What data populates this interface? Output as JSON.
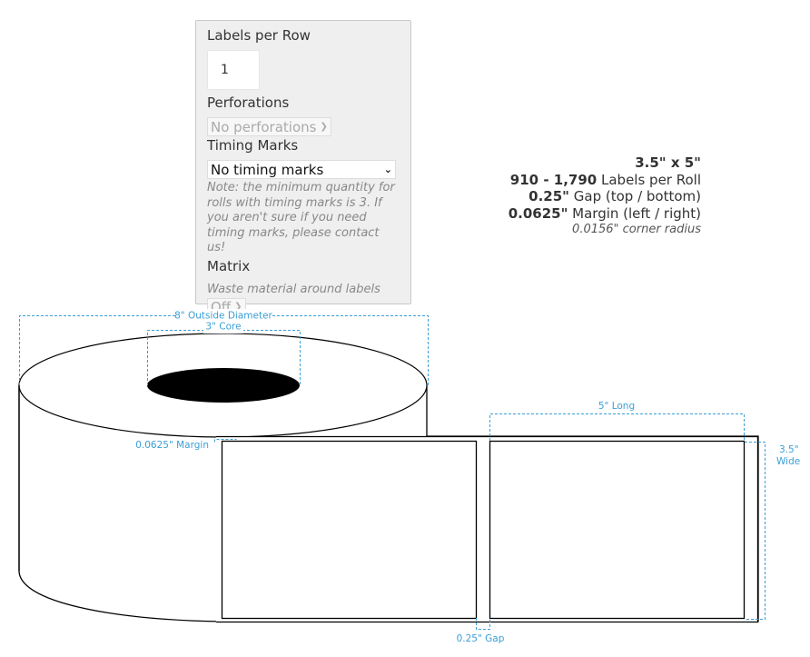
{
  "options_panel": {
    "labels_per_row": {
      "label": "Labels per Row",
      "value": "1"
    },
    "perforations": {
      "label": "Perforations",
      "selected": "No perforations",
      "disabled": true
    },
    "timing_marks": {
      "label": "Timing Marks",
      "selected": "No timing marks",
      "note": "Note: the minimum quantity for rolls with timing marks is 3. If you aren't sure if you need timing marks, please contact us!"
    },
    "matrix": {
      "label": "Matrix",
      "description": "Waste material around labels",
      "selected": "Off",
      "disabled": true
    }
  },
  "specs": {
    "size": "3.5\" x 5\"",
    "labels_per_roll_bold": "910 - 1,790",
    "labels_per_roll_text": " Labels per Roll",
    "gap_bold": "0.25\"",
    "gap_text": " Gap (top / bottom)",
    "margin_bold": "0.0625\"",
    "margin_text": " Margin (left / right)",
    "corner_radius": "0.0156\" corner radius"
  },
  "diagram": {
    "outside_diameter": "8\" Outside Diameter",
    "core": "3\" Core",
    "margin": "0.0625\" Margin",
    "length": "5\" Long",
    "width_line1": "3.5\"",
    "width_line2": "Wide",
    "gap": "0.25\" Gap",
    "colors": {
      "dimension": "#3a9fd6",
      "outline": "#000000"
    }
  }
}
